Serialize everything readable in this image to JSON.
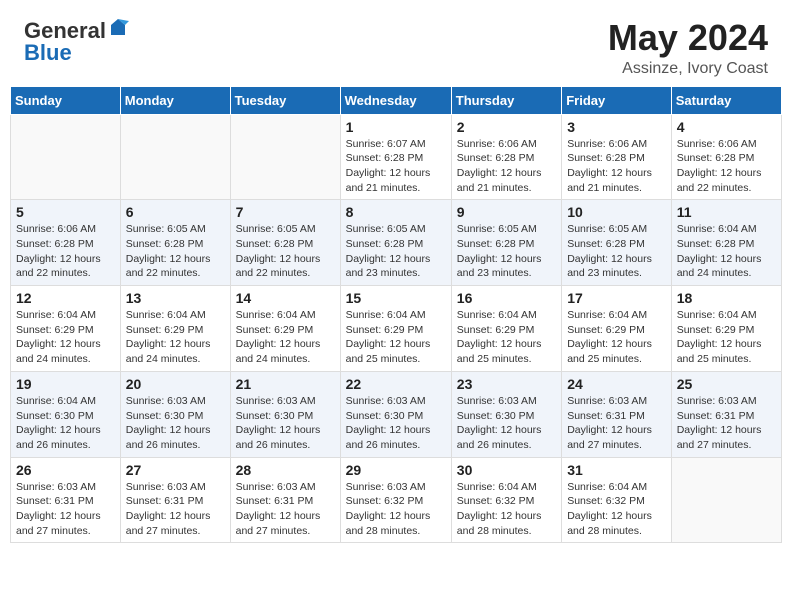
{
  "header": {
    "logo_general": "General",
    "logo_blue": "Blue",
    "month": "May 2024",
    "location": "Assinze, Ivory Coast"
  },
  "days_of_week": [
    "Sunday",
    "Monday",
    "Tuesday",
    "Wednesday",
    "Thursday",
    "Friday",
    "Saturday"
  ],
  "weeks": [
    [
      {
        "day": "",
        "info": ""
      },
      {
        "day": "",
        "info": ""
      },
      {
        "day": "",
        "info": ""
      },
      {
        "day": "1",
        "info": "Sunrise: 6:07 AM\nSunset: 6:28 PM\nDaylight: 12 hours\nand 21 minutes."
      },
      {
        "day": "2",
        "info": "Sunrise: 6:06 AM\nSunset: 6:28 PM\nDaylight: 12 hours\nand 21 minutes."
      },
      {
        "day": "3",
        "info": "Sunrise: 6:06 AM\nSunset: 6:28 PM\nDaylight: 12 hours\nand 21 minutes."
      },
      {
        "day": "4",
        "info": "Sunrise: 6:06 AM\nSunset: 6:28 PM\nDaylight: 12 hours\nand 22 minutes."
      }
    ],
    [
      {
        "day": "5",
        "info": "Sunrise: 6:06 AM\nSunset: 6:28 PM\nDaylight: 12 hours\nand 22 minutes."
      },
      {
        "day": "6",
        "info": "Sunrise: 6:05 AM\nSunset: 6:28 PM\nDaylight: 12 hours\nand 22 minutes."
      },
      {
        "day": "7",
        "info": "Sunrise: 6:05 AM\nSunset: 6:28 PM\nDaylight: 12 hours\nand 22 minutes."
      },
      {
        "day": "8",
        "info": "Sunrise: 6:05 AM\nSunset: 6:28 PM\nDaylight: 12 hours\nand 23 minutes."
      },
      {
        "day": "9",
        "info": "Sunrise: 6:05 AM\nSunset: 6:28 PM\nDaylight: 12 hours\nand 23 minutes."
      },
      {
        "day": "10",
        "info": "Sunrise: 6:05 AM\nSunset: 6:28 PM\nDaylight: 12 hours\nand 23 minutes."
      },
      {
        "day": "11",
        "info": "Sunrise: 6:04 AM\nSunset: 6:28 PM\nDaylight: 12 hours\nand 24 minutes."
      }
    ],
    [
      {
        "day": "12",
        "info": "Sunrise: 6:04 AM\nSunset: 6:29 PM\nDaylight: 12 hours\nand 24 minutes."
      },
      {
        "day": "13",
        "info": "Sunrise: 6:04 AM\nSunset: 6:29 PM\nDaylight: 12 hours\nand 24 minutes."
      },
      {
        "day": "14",
        "info": "Sunrise: 6:04 AM\nSunset: 6:29 PM\nDaylight: 12 hours\nand 24 minutes."
      },
      {
        "day": "15",
        "info": "Sunrise: 6:04 AM\nSunset: 6:29 PM\nDaylight: 12 hours\nand 25 minutes."
      },
      {
        "day": "16",
        "info": "Sunrise: 6:04 AM\nSunset: 6:29 PM\nDaylight: 12 hours\nand 25 minutes."
      },
      {
        "day": "17",
        "info": "Sunrise: 6:04 AM\nSunset: 6:29 PM\nDaylight: 12 hours\nand 25 minutes."
      },
      {
        "day": "18",
        "info": "Sunrise: 6:04 AM\nSunset: 6:29 PM\nDaylight: 12 hours\nand 25 minutes."
      }
    ],
    [
      {
        "day": "19",
        "info": "Sunrise: 6:04 AM\nSunset: 6:30 PM\nDaylight: 12 hours\nand 26 minutes."
      },
      {
        "day": "20",
        "info": "Sunrise: 6:03 AM\nSunset: 6:30 PM\nDaylight: 12 hours\nand 26 minutes."
      },
      {
        "day": "21",
        "info": "Sunrise: 6:03 AM\nSunset: 6:30 PM\nDaylight: 12 hours\nand 26 minutes."
      },
      {
        "day": "22",
        "info": "Sunrise: 6:03 AM\nSunset: 6:30 PM\nDaylight: 12 hours\nand 26 minutes."
      },
      {
        "day": "23",
        "info": "Sunrise: 6:03 AM\nSunset: 6:30 PM\nDaylight: 12 hours\nand 26 minutes."
      },
      {
        "day": "24",
        "info": "Sunrise: 6:03 AM\nSunset: 6:31 PM\nDaylight: 12 hours\nand 27 minutes."
      },
      {
        "day": "25",
        "info": "Sunrise: 6:03 AM\nSunset: 6:31 PM\nDaylight: 12 hours\nand 27 minutes."
      }
    ],
    [
      {
        "day": "26",
        "info": "Sunrise: 6:03 AM\nSunset: 6:31 PM\nDaylight: 12 hours\nand 27 minutes."
      },
      {
        "day": "27",
        "info": "Sunrise: 6:03 AM\nSunset: 6:31 PM\nDaylight: 12 hours\nand 27 minutes."
      },
      {
        "day": "28",
        "info": "Sunrise: 6:03 AM\nSunset: 6:31 PM\nDaylight: 12 hours\nand 27 minutes."
      },
      {
        "day": "29",
        "info": "Sunrise: 6:03 AM\nSunset: 6:32 PM\nDaylight: 12 hours\nand 28 minutes."
      },
      {
        "day": "30",
        "info": "Sunrise: 6:04 AM\nSunset: 6:32 PM\nDaylight: 12 hours\nand 28 minutes."
      },
      {
        "day": "31",
        "info": "Sunrise: 6:04 AM\nSunset: 6:32 PM\nDaylight: 12 hours\nand 28 minutes."
      },
      {
        "day": "",
        "info": ""
      }
    ]
  ]
}
